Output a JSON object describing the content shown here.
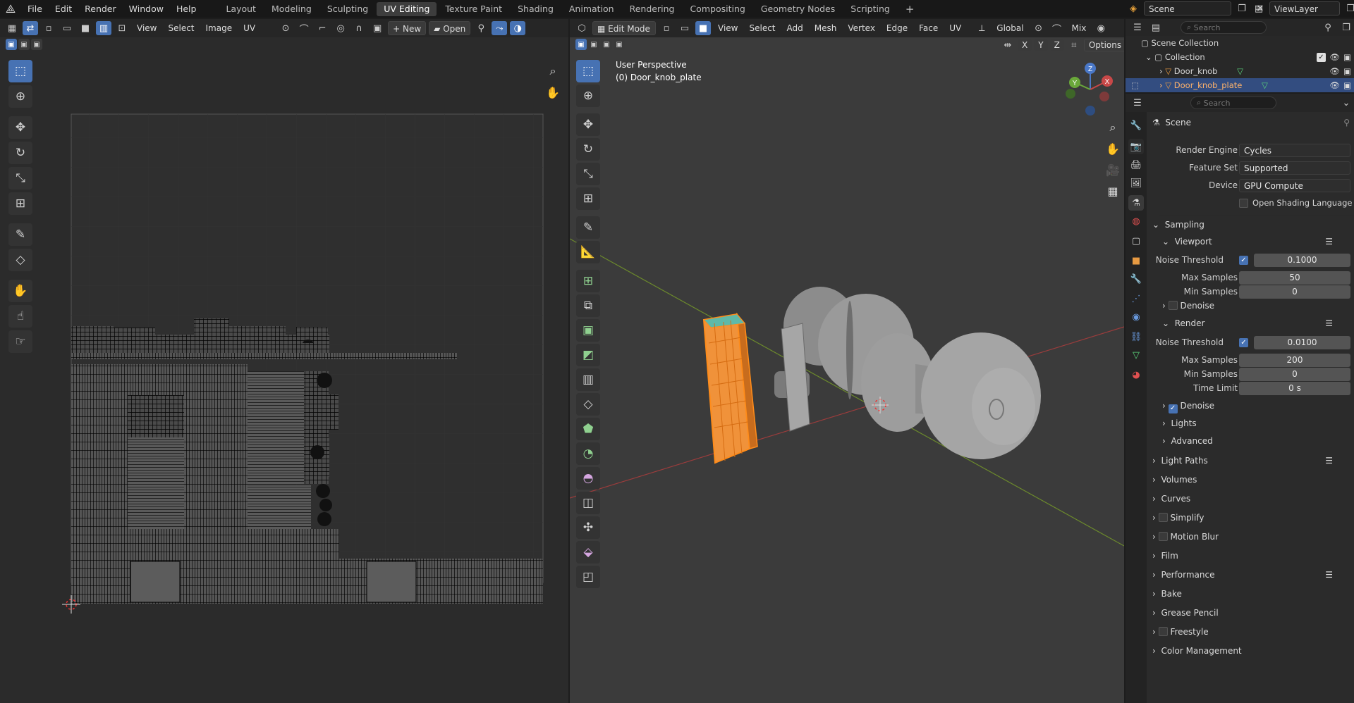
{
  "topbar": {
    "menus": [
      "File",
      "Edit",
      "Render",
      "Window",
      "Help"
    ],
    "workspaces": [
      "Layout",
      "Modeling",
      "Sculpting",
      "UV Editing",
      "Texture Paint",
      "Shading",
      "Animation",
      "Rendering",
      "Compositing",
      "Geometry Nodes",
      "Scripting"
    ],
    "active_workspace": "UV Editing",
    "add_tab": "+",
    "scene": "Scene",
    "view_layer": "ViewLayer"
  },
  "uv_editor": {
    "menus": [
      "View",
      "Select",
      "Image",
      "UV"
    ],
    "new_label": "New",
    "open_label": "Open"
  },
  "viewport": {
    "mode": "Edit Mode",
    "menus": [
      "View",
      "Select",
      "Add",
      "Mesh",
      "Vertex",
      "Edge",
      "Face",
      "UV"
    ],
    "orientation": "Global",
    "shading_mix": "Mix",
    "options_label": "Options",
    "axes": [
      "X",
      "Y",
      "Z"
    ],
    "perspective": "User Perspective",
    "object_label": "(0) Door_knob_plate",
    "gizmo": {
      "x": "X",
      "y": "Y",
      "z": "Z"
    }
  },
  "outliner": {
    "search_placeholder": "Search",
    "root": "Scene Collection",
    "collection": "Collection",
    "items": [
      {
        "name": "Door_knob",
        "selected": false
      },
      {
        "name": "Door_knob_plate",
        "selected": true
      }
    ]
  },
  "properties": {
    "search_placeholder": "Search",
    "context": "Scene",
    "render_engine_label": "Render Engine",
    "render_engine": "Cycles",
    "feature_set_label": "Feature Set",
    "feature_set": "Supported",
    "device_label": "Device",
    "device": "GPU Compute",
    "osl_label": "Open Shading Language",
    "sampling_label": "Sampling",
    "viewport_label": "Viewport",
    "viewport_noise_label": "Noise Threshold",
    "viewport_noise": "0.1000",
    "viewport_max_label": "Max Samples",
    "viewport_max": "50",
    "viewport_min_label": "Min Samples",
    "viewport_min": "0",
    "viewport_denoise_label": "Denoise",
    "render_label": "Render",
    "render_noise_label": "Noise Threshold",
    "render_noise": "0.0100",
    "render_max_label": "Max Samples",
    "render_max": "200",
    "render_min_label": "Min Samples",
    "render_min": "0",
    "time_limit_label": "Time Limit",
    "time_limit": "0 s",
    "render_denoise_label": "Denoise",
    "lights_label": "Lights",
    "advanced_label": "Advanced",
    "panels": [
      "Light Paths",
      "Volumes",
      "Curves",
      "Simplify",
      "Motion Blur",
      "Film",
      "Performance",
      "Bake",
      "Grease Pencil",
      "Freestyle",
      "Color Management"
    ]
  },
  "colors": {
    "accent": "#4772b3",
    "selection_orange": "#ff8c1a",
    "bg_dark": "#1d1d1d"
  }
}
